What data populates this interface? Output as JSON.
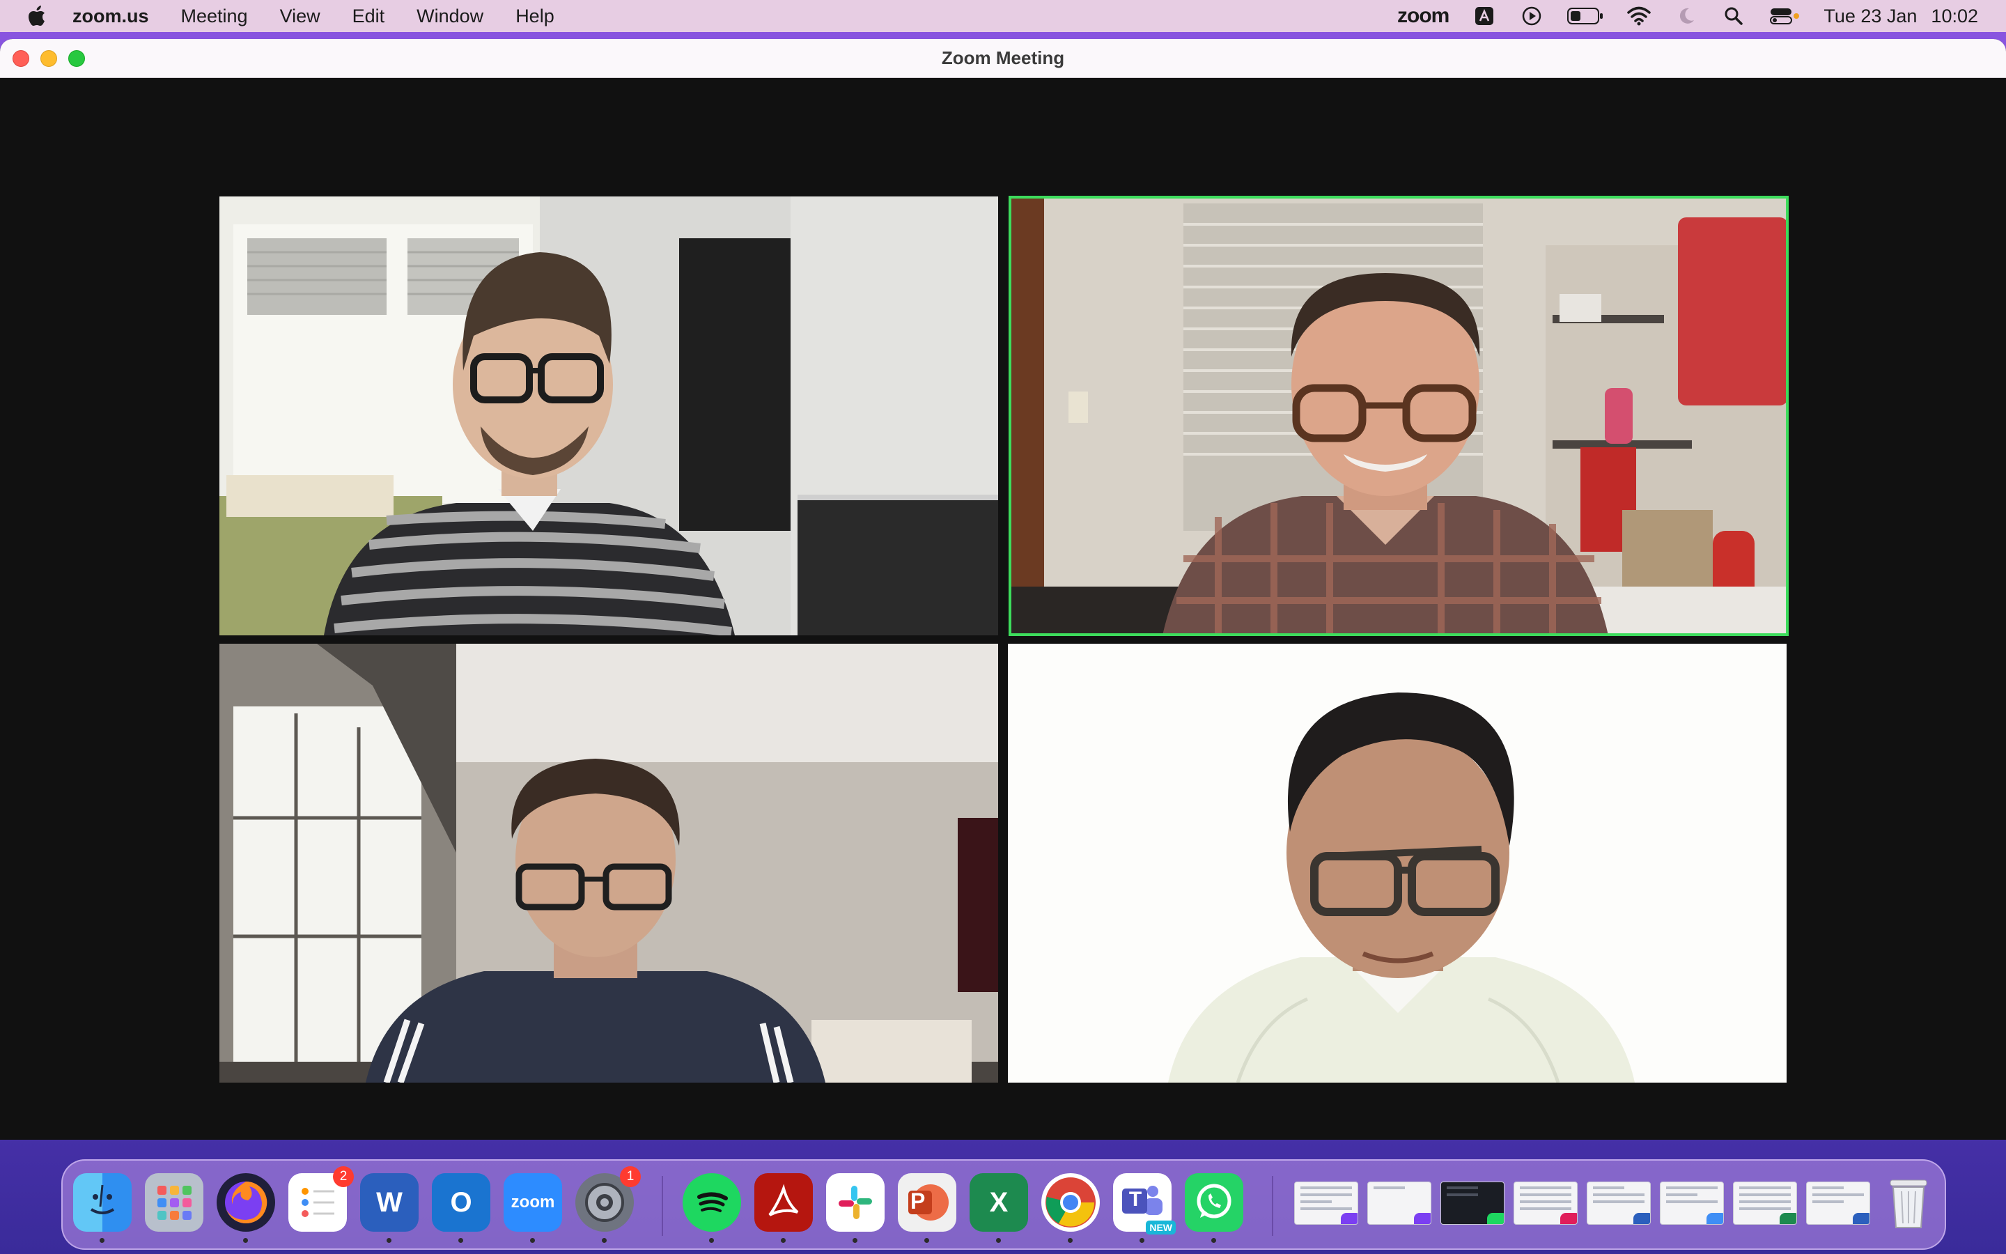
{
  "menubar": {
    "app_name": "zoom.us",
    "menus": [
      "Meeting",
      "View",
      "Edit",
      "Window",
      "Help"
    ],
    "status_app": "zoom",
    "date": "Tue 23 Jan",
    "time": "10:02"
  },
  "window": {
    "title": "Zoom Meeting",
    "active_speaker_color": "#3ddc5c"
  },
  "participants": [
    {
      "id": "participant-1",
      "active_speaker": false
    },
    {
      "id": "participant-2",
      "active_speaker": true
    },
    {
      "id": "participant-3",
      "active_speaker": false
    },
    {
      "id": "participant-4",
      "active_speaker": false
    }
  ],
  "dock": {
    "apps": [
      {
        "name": "Finder",
        "icon": "finder-icon"
      },
      {
        "name": "Launchpad",
        "icon": "launchpad-icon"
      },
      {
        "name": "Firefox",
        "icon": "firefox-icon"
      },
      {
        "name": "Reminders",
        "icon": "reminders-icon",
        "badge": "2"
      },
      {
        "name": "Microsoft Word",
        "icon": "word-icon",
        "glyph": "W"
      },
      {
        "name": "Microsoft Outlook",
        "icon": "outlook-icon",
        "glyph": "O"
      },
      {
        "name": "Zoom",
        "icon": "zoom-icon",
        "glyph": "zoom"
      },
      {
        "name": "System Settings",
        "icon": "settings-icon",
        "badge": "1"
      },
      {
        "name": "Spotify",
        "icon": "spotify-icon"
      },
      {
        "name": "Adobe Acrobat",
        "icon": "acrobat-icon"
      },
      {
        "name": "Slack",
        "icon": "slack-icon"
      },
      {
        "name": "Microsoft PowerPoint",
        "icon": "powerpoint-icon",
        "glyph": "P"
      },
      {
        "name": "Microsoft Excel",
        "icon": "excel-icon",
        "glyph": "X"
      },
      {
        "name": "Google Chrome",
        "icon": "chrome-icon"
      },
      {
        "name": "Microsoft Teams",
        "icon": "teams-icon",
        "glyph": "T",
        "new_label": "NEW"
      },
      {
        "name": "WhatsApp",
        "icon": "whatsapp-icon"
      }
    ],
    "minimized_windows": 8,
    "trash": "trash-icon"
  }
}
